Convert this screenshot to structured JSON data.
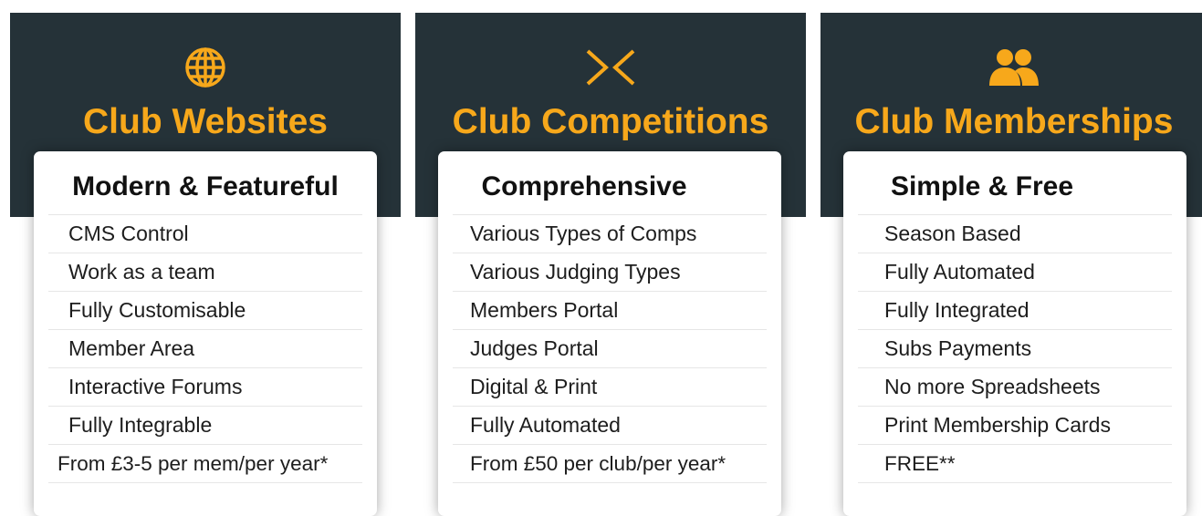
{
  "colors": {
    "header_bg": "#253238",
    "accent": "#f7a81b",
    "card_bg": "#ffffff",
    "text": "#1d1d1d"
  },
  "columns": [
    {
      "icon": "globe-icon",
      "title": "Club Websites",
      "card_title": "Modern & Featureful",
      "features": [
        "CMS Control",
        "Work as a team",
        "Fully Customisable",
        "Member Area",
        "Interactive Forums",
        "Fully Integrable"
      ],
      "price": "From £3-5 per mem/per year*"
    },
    {
      "icon": "competition-arrows-icon",
      "title": "Club Competitions",
      "card_title": "Comprehensive",
      "features": [
        "Various Types of Comps",
        "Various Judging Types",
        "Members Portal",
        "Judges Portal",
        "Digital & Print",
        "Fully Automated"
      ],
      "price": "From £50 per club/per year*"
    },
    {
      "icon": "users-icon",
      "title": "Club Memberships",
      "card_title": "Simple & Free",
      "features": [
        "Season Based",
        "Fully Automated",
        "Fully Integrated",
        "Subs Payments",
        "No more Spreadsheets",
        "Print Membership Cards"
      ],
      "price": "FREE**"
    }
  ]
}
